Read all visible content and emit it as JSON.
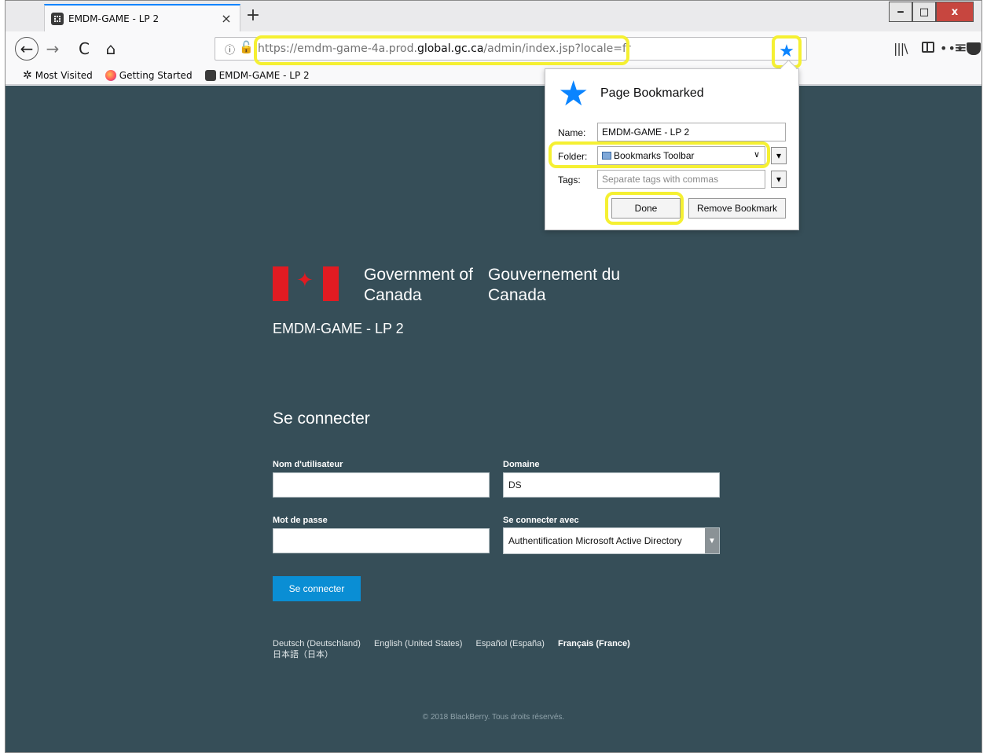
{
  "tab": {
    "title": "EMDM-GAME - LP 2",
    "close": "×"
  },
  "new_tab": "+",
  "window_controls": {
    "minimize": "‒",
    "maximize": "□",
    "close": "x"
  },
  "nav": {
    "back": "←",
    "forward": "→",
    "reload": "C",
    "home": "⌂"
  },
  "url": {
    "prefix": "https://emdm-game-4a.prod.",
    "domain": "global.gc.ca",
    "suffix": "/admin/index.jsp?locale=fr",
    "more": "•••"
  },
  "bookmarks_bar": [
    {
      "label": "Most Visited",
      "icon": "gear-icon"
    },
    {
      "label": "Getting Started",
      "icon": "firefox-icon"
    },
    {
      "label": "EMDM-GAME - LP 2",
      "icon": "blackberry-icon"
    }
  ],
  "bookmark_panel": {
    "title": "Page Bookmarked",
    "name_label": "Name:",
    "name_value": "EMDM-GAME - LP 2",
    "folder_label": "Folder:",
    "folder_value": "Bookmarks Toolbar",
    "tags_label": "Tags:",
    "tags_placeholder": "Separate tags with commas",
    "done": "Done",
    "remove": "Remove Bookmark"
  },
  "page": {
    "gov_en": "Government of Canada",
    "gov_fr": "Gouvernement du Canada",
    "site_title": "EMDM-GAME - LP 2",
    "login_heading": "Se connecter",
    "username_label": "Nom d'utilisateur",
    "username_value": "",
    "domain_label": "Domaine",
    "domain_value": "DS",
    "password_label": "Mot de passe",
    "password_value": "",
    "login_with_label": "Se connecter avec",
    "login_with_value": "Authentification Microsoft Active Directory",
    "login_button": "Se connecter",
    "languages": [
      "Deutsch (Deutschland)",
      "English (United States)",
      "Español (España)",
      "Français (France)",
      "日本語（日本）"
    ],
    "copyright": "© 2018 BlackBerry. Tous droits réservés."
  }
}
